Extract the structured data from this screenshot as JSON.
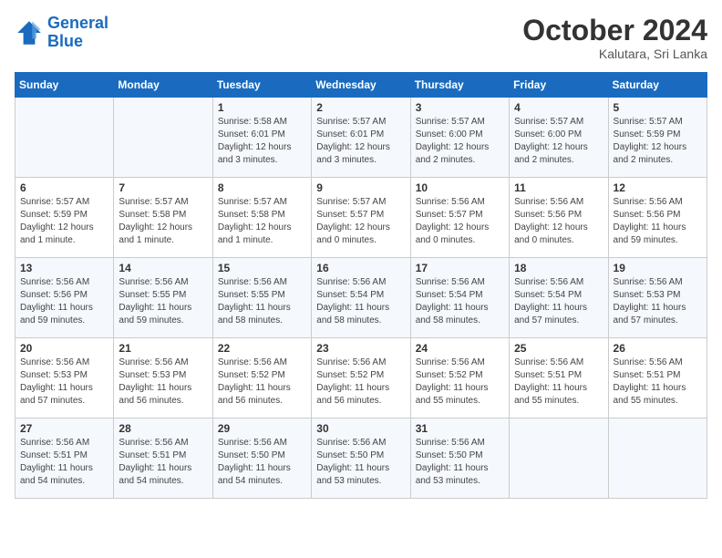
{
  "header": {
    "logo_line1": "General",
    "logo_line2": "Blue",
    "month": "October 2024",
    "location": "Kalutara, Sri Lanka"
  },
  "days_of_week": [
    "Sunday",
    "Monday",
    "Tuesday",
    "Wednesday",
    "Thursday",
    "Friday",
    "Saturday"
  ],
  "weeks": [
    [
      {
        "day": "",
        "info": ""
      },
      {
        "day": "",
        "info": ""
      },
      {
        "day": "1",
        "info": "Sunrise: 5:58 AM\nSunset: 6:01 PM\nDaylight: 12 hours\nand 3 minutes."
      },
      {
        "day": "2",
        "info": "Sunrise: 5:57 AM\nSunset: 6:01 PM\nDaylight: 12 hours\nand 3 minutes."
      },
      {
        "day": "3",
        "info": "Sunrise: 5:57 AM\nSunset: 6:00 PM\nDaylight: 12 hours\nand 2 minutes."
      },
      {
        "day": "4",
        "info": "Sunrise: 5:57 AM\nSunset: 6:00 PM\nDaylight: 12 hours\nand 2 minutes."
      },
      {
        "day": "5",
        "info": "Sunrise: 5:57 AM\nSunset: 5:59 PM\nDaylight: 12 hours\nand 2 minutes."
      }
    ],
    [
      {
        "day": "6",
        "info": "Sunrise: 5:57 AM\nSunset: 5:59 PM\nDaylight: 12 hours\nand 1 minute."
      },
      {
        "day": "7",
        "info": "Sunrise: 5:57 AM\nSunset: 5:58 PM\nDaylight: 12 hours\nand 1 minute."
      },
      {
        "day": "8",
        "info": "Sunrise: 5:57 AM\nSunset: 5:58 PM\nDaylight: 12 hours\nand 1 minute."
      },
      {
        "day": "9",
        "info": "Sunrise: 5:57 AM\nSunset: 5:57 PM\nDaylight: 12 hours\nand 0 minutes."
      },
      {
        "day": "10",
        "info": "Sunrise: 5:56 AM\nSunset: 5:57 PM\nDaylight: 12 hours\nand 0 minutes."
      },
      {
        "day": "11",
        "info": "Sunrise: 5:56 AM\nSunset: 5:56 PM\nDaylight: 12 hours\nand 0 minutes."
      },
      {
        "day": "12",
        "info": "Sunrise: 5:56 AM\nSunset: 5:56 PM\nDaylight: 11 hours\nand 59 minutes."
      }
    ],
    [
      {
        "day": "13",
        "info": "Sunrise: 5:56 AM\nSunset: 5:56 PM\nDaylight: 11 hours\nand 59 minutes."
      },
      {
        "day": "14",
        "info": "Sunrise: 5:56 AM\nSunset: 5:55 PM\nDaylight: 11 hours\nand 59 minutes."
      },
      {
        "day": "15",
        "info": "Sunrise: 5:56 AM\nSunset: 5:55 PM\nDaylight: 11 hours\nand 58 minutes."
      },
      {
        "day": "16",
        "info": "Sunrise: 5:56 AM\nSunset: 5:54 PM\nDaylight: 11 hours\nand 58 minutes."
      },
      {
        "day": "17",
        "info": "Sunrise: 5:56 AM\nSunset: 5:54 PM\nDaylight: 11 hours\nand 58 minutes."
      },
      {
        "day": "18",
        "info": "Sunrise: 5:56 AM\nSunset: 5:54 PM\nDaylight: 11 hours\nand 57 minutes."
      },
      {
        "day": "19",
        "info": "Sunrise: 5:56 AM\nSunset: 5:53 PM\nDaylight: 11 hours\nand 57 minutes."
      }
    ],
    [
      {
        "day": "20",
        "info": "Sunrise: 5:56 AM\nSunset: 5:53 PM\nDaylight: 11 hours\nand 57 minutes."
      },
      {
        "day": "21",
        "info": "Sunrise: 5:56 AM\nSunset: 5:53 PM\nDaylight: 11 hours\nand 56 minutes."
      },
      {
        "day": "22",
        "info": "Sunrise: 5:56 AM\nSunset: 5:52 PM\nDaylight: 11 hours\nand 56 minutes."
      },
      {
        "day": "23",
        "info": "Sunrise: 5:56 AM\nSunset: 5:52 PM\nDaylight: 11 hours\nand 56 minutes."
      },
      {
        "day": "24",
        "info": "Sunrise: 5:56 AM\nSunset: 5:52 PM\nDaylight: 11 hours\nand 55 minutes."
      },
      {
        "day": "25",
        "info": "Sunrise: 5:56 AM\nSunset: 5:51 PM\nDaylight: 11 hours\nand 55 minutes."
      },
      {
        "day": "26",
        "info": "Sunrise: 5:56 AM\nSunset: 5:51 PM\nDaylight: 11 hours\nand 55 minutes."
      }
    ],
    [
      {
        "day": "27",
        "info": "Sunrise: 5:56 AM\nSunset: 5:51 PM\nDaylight: 11 hours\nand 54 minutes."
      },
      {
        "day": "28",
        "info": "Sunrise: 5:56 AM\nSunset: 5:51 PM\nDaylight: 11 hours\nand 54 minutes."
      },
      {
        "day": "29",
        "info": "Sunrise: 5:56 AM\nSunset: 5:50 PM\nDaylight: 11 hours\nand 54 minutes."
      },
      {
        "day": "30",
        "info": "Sunrise: 5:56 AM\nSunset: 5:50 PM\nDaylight: 11 hours\nand 53 minutes."
      },
      {
        "day": "31",
        "info": "Sunrise: 5:56 AM\nSunset: 5:50 PM\nDaylight: 11 hours\nand 53 minutes."
      },
      {
        "day": "",
        "info": ""
      },
      {
        "day": "",
        "info": ""
      }
    ]
  ]
}
